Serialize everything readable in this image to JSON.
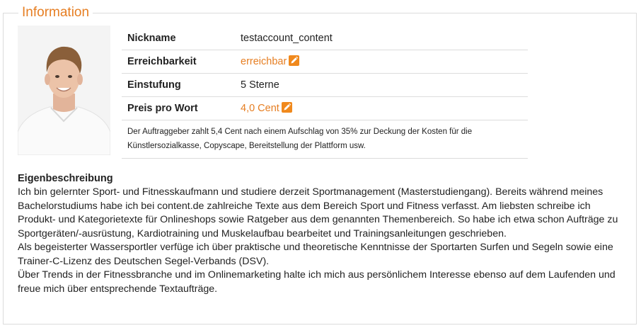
{
  "section": {
    "legend": "Information"
  },
  "profile": {
    "rows": [
      {
        "label": "Nickname",
        "value": "testaccount_content"
      },
      {
        "label": "Erreichbarkeit",
        "value": "erreichbar"
      },
      {
        "label": "Einstufung",
        "value": "5 Sterne"
      },
      {
        "label": "Preis pro Wort",
        "value": "4,0 Cent"
      }
    ],
    "note": "Der Auftraggeber zahlt 5,4 Cent nach einem Aufschlag von 35% zur Deckung der Kosten für die Künstlersozialkasse, Copyscape, Bereitstellung der Plattform usw."
  },
  "description": {
    "title": "Eigenbeschreibung",
    "paragraphs": [
      "Ich bin gelernter Sport- und Fitnesskaufmann und studiere derzeit Sportmanagement (Masterstudiengang). Bereits während meines Bachelorstudiums habe ich bei content.de zahlreiche Texte aus dem Bereich Sport und Fitness verfasst. Am liebsten schreibe ich Produkt- und Kategorietexte für Onlineshops sowie Ratgeber aus dem genannten Themenbereich. So habe ich etwa schon Aufträge zu Sportgeräten/-ausrüstung, Kardiotraining und Muskelaufbau bearbeitet und Trainingsanleitungen geschrieben.",
      "Als begeisterter Wassersportler verfüge ich über praktische und theoretische Kenntnisse der Sportarten Surfen und Segeln sowie eine Trainer-C-Lizenz des Deutschen Segel-Verbands (DSV).",
      "Über Trends in der Fitnessbranche und im Onlinemarketing halte ich mich aus persönlichem Interesse ebenso auf dem Laufenden und freue mich über entsprechende Textaufträge."
    ]
  },
  "colors": {
    "accent": "#e67e22",
    "border": "#dcdcdc"
  }
}
